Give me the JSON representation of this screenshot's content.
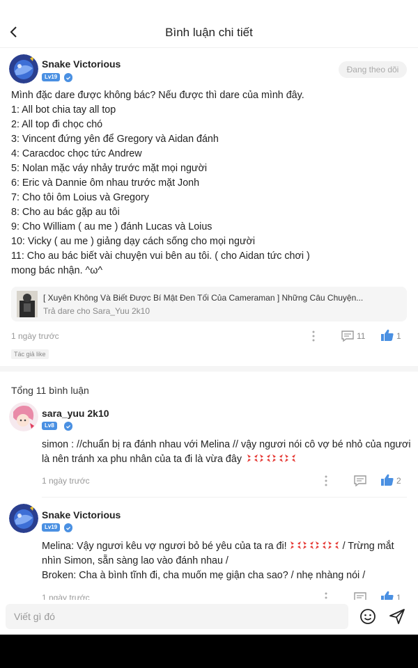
{
  "header": {
    "title": "Bình luận chi tiết"
  },
  "post": {
    "author": "Snake Victorious",
    "level": "Lv19",
    "follow_label": "Đang theo dõi",
    "lines": [
      "Mình đặc dare được không bác? Nếu được thì dare của mình đây.",
      "1: All bot chia tay all top",
      "2: All top đi chọc chó",
      "3: Vincent đứng yên để Gregory và Aidan đánh",
      "4: Caracdoc chọc tức Andrew",
      "5: Nolan mặc váy nhảy trước mặt mọi người",
      "6: Eric và Dannie ôm nhau trước mặt Jonh",
      "7: Cho tôi ôm Loius và Gregory",
      "8: Cho au bác gặp au tôi",
      "9: Cho William ( au me ) đánh Lucas và Loius",
      "10: Vicky ( au me ) giảng dạy cách sống cho mọi người",
      "11: Cho au bác biết vài chuyện vui bên au tôi. ( cho Aidan tức chơi )",
      "mong bác nhận. ^ω^"
    ],
    "link": {
      "title": "[ Xuyên Không Và Biết Được Bí Mật Đen Tối Của Cameraman ] Những Câu Chuyện...",
      "subtitle": "Trả dare cho Sara_Yuu 2k10"
    },
    "time": "1 ngày trước",
    "reply_count": "11",
    "like_count": "1",
    "tag": "Tác giả like"
  },
  "total_label": "Tổng 11 bình luận",
  "comments": [
    {
      "author": "sara_yuu 2k10",
      "level": "Lv8",
      "line1": "simon : //chuẩn bị ra đánh nhau với Melina // vậy ngươi nói cô vợ bé nhỏ của ngươi",
      "line2": "là nên tránh xa phu nhân của ta đi là vừa đây",
      "time": "1 ngày trước",
      "like_count": "2"
    },
    {
      "author": "Snake Victorious",
      "level": "Lv19",
      "line1a": "Melina: Vậy ngươi kêu vợ ngươi bỏ bé yêu của ta ra đi!",
      "line1b": " / Trừng mắt",
      "line2": "nhìn Simon, sẵn sàng lao vào đánh nhau /",
      "line3": "Broken: Cha à bình tĩnh đi, cha muốn mẹ giận cha sao? / nhẹ nhàng nói /",
      "time": "1 ngày trước",
      "like_count": "1"
    }
  ],
  "composer": {
    "placeholder": "Viết gì đó"
  },
  "colors": {
    "accent": "#4a90e2",
    "like": "#4a90e2",
    "anger_emoji": "#e53935"
  }
}
